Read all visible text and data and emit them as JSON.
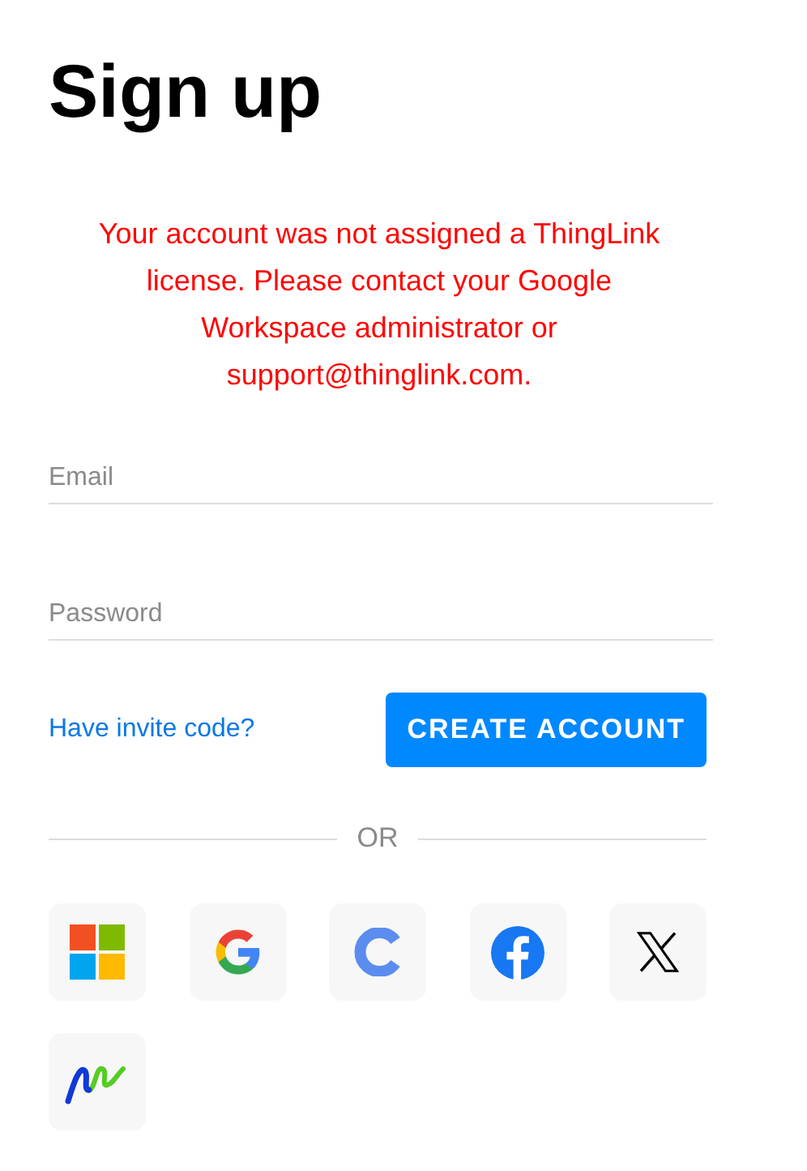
{
  "title": "Sign up",
  "error_message": "Your account was not assigned a ThingLink license. Please contact your Google Workspace administrator or support@thinglink.com.",
  "fields": [
    {
      "placeholder": "Email"
    },
    {
      "placeholder": "Password"
    }
  ],
  "invite_link": "Have invite code?",
  "submit_button": "CREATE ACCOUNT",
  "divider_text": "OR",
  "providers": [
    {
      "kind": "microsoft"
    },
    {
      "kind": "google"
    },
    {
      "kind": "c"
    },
    {
      "kind": "facebook"
    },
    {
      "kind": "x"
    },
    {
      "kind": "squiggle"
    }
  ]
}
